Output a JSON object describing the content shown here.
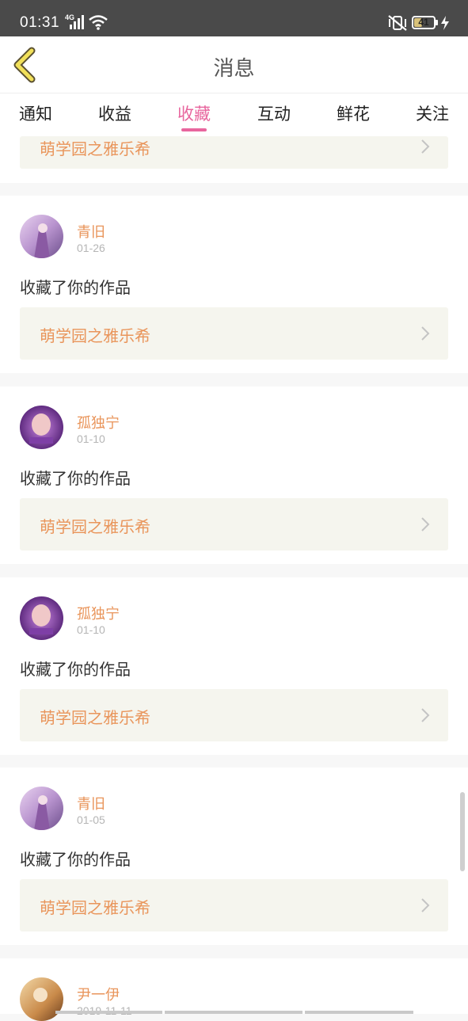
{
  "status_bar": {
    "time": "01:31",
    "network": "4G",
    "battery": "41",
    "battery_fraction": 0.41
  },
  "header": {
    "title": "消息",
    "back_icon": "chevron-left-icon"
  },
  "tabs": [
    {
      "label": "通知",
      "active": false
    },
    {
      "label": "收益",
      "active": false
    },
    {
      "label": "收藏",
      "active": true
    },
    {
      "label": "互动",
      "active": false
    },
    {
      "label": "鲜花",
      "active": false
    },
    {
      "label": "关注",
      "active": false
    }
  ],
  "colors": {
    "accent": "#e8669e",
    "name": "#e9955b",
    "work_bg": "#f5f5ee"
  },
  "partial_top": {
    "work_title": "萌学园之雅乐希"
  },
  "items": [
    {
      "user": "青旧",
      "date": "01-26",
      "action": "收藏了你的作品",
      "work_title": "萌学园之雅乐希"
    },
    {
      "user": "孤独宁",
      "date": "01-10",
      "action": "收藏了你的作品",
      "work_title": "萌学园之雅乐希"
    },
    {
      "user": "孤独宁",
      "date": "01-10",
      "action": "收藏了你的作品",
      "work_title": "萌学园之雅乐希"
    },
    {
      "user": "青旧",
      "date": "01-05",
      "action": "收藏了你的作品",
      "work_title": "萌学园之雅乐希"
    },
    {
      "user": "尹一伊",
      "date": "2019-11-11"
    }
  ]
}
